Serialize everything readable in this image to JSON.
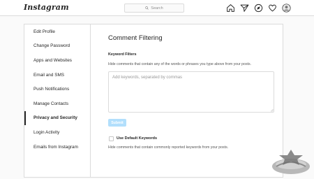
{
  "header": {
    "logo_text": "Instagram",
    "search_placeholder": "Search",
    "nav_icons": [
      "home-icon",
      "direct-message-icon",
      "explore-icon",
      "activity-heart-icon",
      "profile-avatar-icon"
    ]
  },
  "sidebar": {
    "items": [
      {
        "label": "Edit Profile"
      },
      {
        "label": "Change Password"
      },
      {
        "label": "Apps and Websites"
      },
      {
        "label": "Email and SMS"
      },
      {
        "label": "Push Notifications"
      },
      {
        "label": "Manage Contacts"
      },
      {
        "label": "Privacy and Security"
      },
      {
        "label": "Login Activity"
      },
      {
        "label": "Emails from Instagram"
      }
    ],
    "active": "Privacy and Security"
  },
  "main": {
    "title": "Comment Filtering",
    "keyword_filters": {
      "label": "Keyword Filters",
      "description": "Hide comments that contain any of the words or phrases you type above from your posts.",
      "input_placeholder": "Add keywords, separated by commas",
      "input_value": ""
    },
    "submit_label": "Submit",
    "default_keywords": {
      "checked": false,
      "label": "Use Default Keywords",
      "description": "Hide comments that contain commonly reported keywords from your posts."
    }
  },
  "colors": {
    "accent_disabled": "#b2dffc",
    "border": "#dbdbdb",
    "background": "#fafafa"
  }
}
